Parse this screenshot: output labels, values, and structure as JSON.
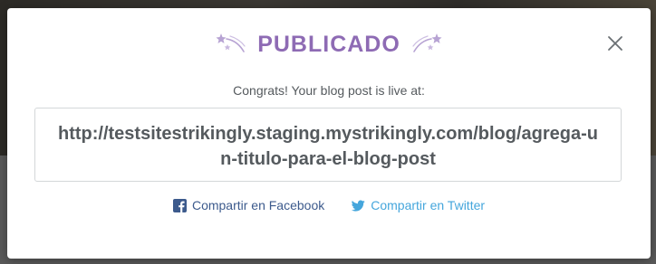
{
  "modal": {
    "title": "PUBLICADO",
    "subtitle": "Congrats! Your blog post is live at:",
    "url": "http://testsitestrikingly.staging.mystrikingly.com/blog/agrega-un-titulo-para-el-blog-post",
    "close_icon": "close-icon",
    "left_decoration_icon": "shooting-stars-icon",
    "right_decoration_icon": "shooting-stars-icon"
  },
  "share": {
    "facebook_label": "Compartir en Facebook",
    "facebook_icon": "facebook-icon",
    "twitter_label": "Compartir en Twitter",
    "twitter_icon": "twitter-icon"
  },
  "colors": {
    "title": "#8e6bb4",
    "text": "#555a5e",
    "facebook": "#3c5a8c",
    "twitter": "#45a6dc"
  }
}
